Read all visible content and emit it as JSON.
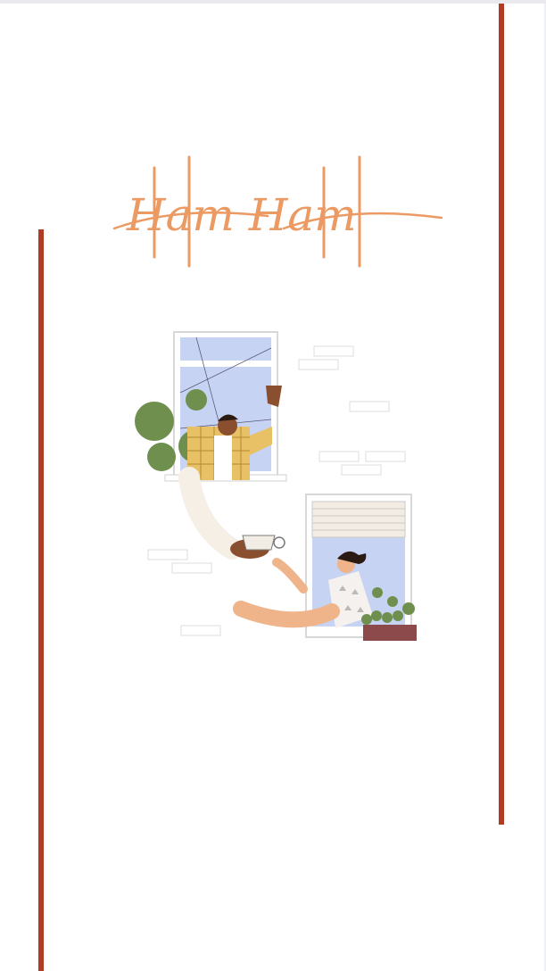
{
  "title": {
    "text": "Ham Ham",
    "color": "#ec9a63"
  },
  "colors": {
    "accent_line": "#b23b25",
    "window_sky": "#c7d3f2",
    "plant_green": "#6f8f4e",
    "shirt_yellow": "#e8c065",
    "skin_light": "#efb48a",
    "skin_dark": "#8a4f2e"
  },
  "illustration": {
    "icon": "neighbors-sharing-coffee-illustration"
  }
}
